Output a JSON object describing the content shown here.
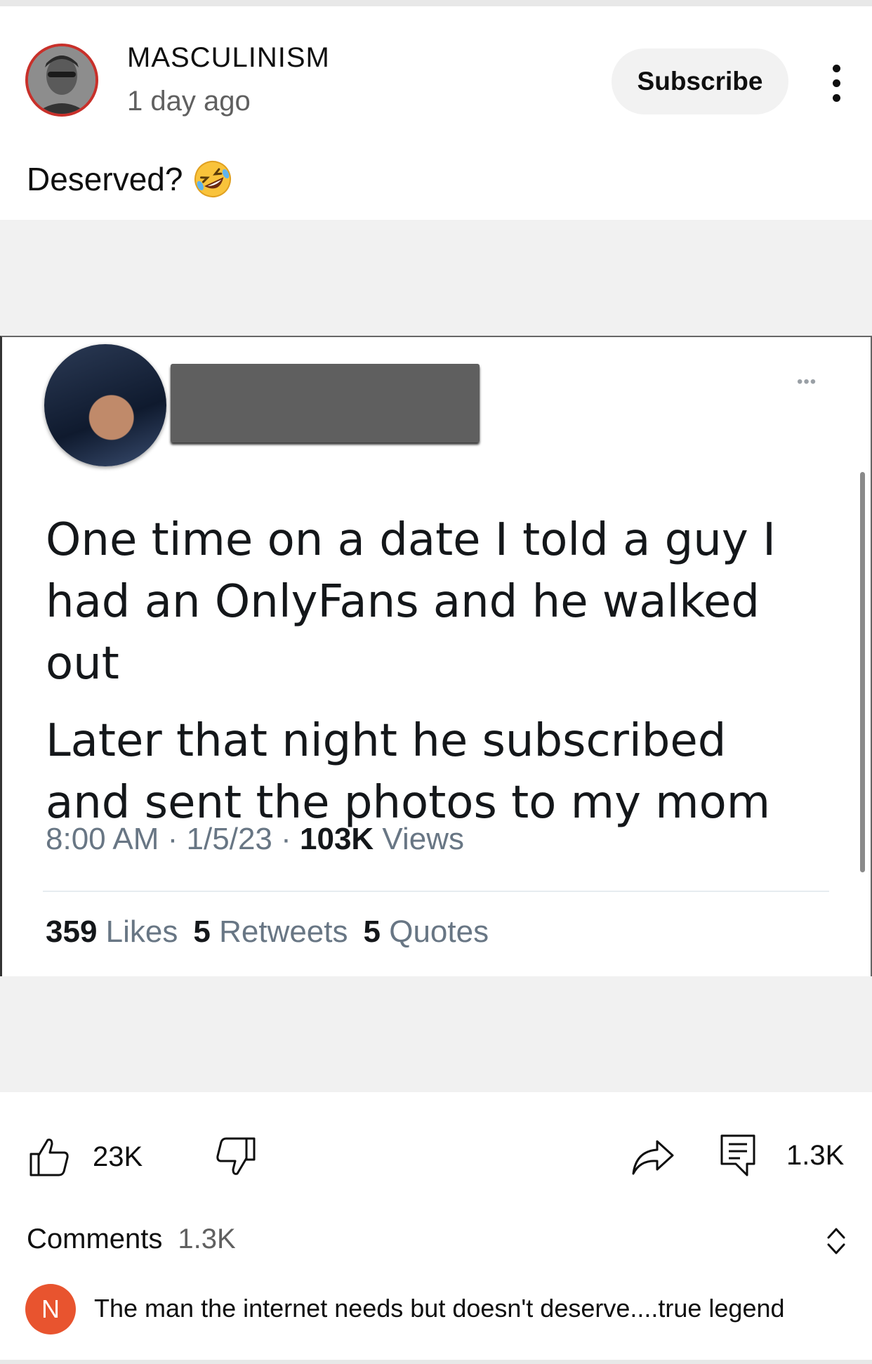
{
  "post": {
    "channel_name": "MASCULINISM",
    "time_ago": "1 day ago",
    "subscribe_label": "Subscribe",
    "caption": "Deserved?",
    "caption_emoji": "rolling-on-floor-laughing-emoji"
  },
  "tweet": {
    "paragraph_1": "One time on a date I told a guy I had an OnlyFans and he walked out",
    "paragraph_2": "Later that night he subscribed and sent the photos to my mom",
    "time": "8:00 AM",
    "date": "1/5/23",
    "views_count": "103K",
    "views_label": "Views",
    "likes_count": "359",
    "likes_label": "Likes",
    "retweets_count": "5",
    "retweets_label": "Retweets",
    "quotes_count": "5",
    "quotes_label": "Quotes",
    "more_glyph": "•••"
  },
  "actions": {
    "like_count": "23K",
    "comment_count": "1.3K"
  },
  "comments": {
    "label": "Comments",
    "count": "1.3K",
    "first": {
      "avatar_letter": "N",
      "text": "The man the internet needs but doesn't deserve....true legend"
    }
  },
  "colors": {
    "avatar_ring": "#c8302a",
    "commenter_avatar": "#e8542f",
    "subscribe_bg": "#f2f2f2"
  }
}
